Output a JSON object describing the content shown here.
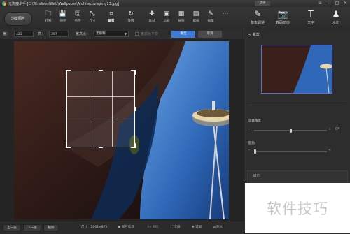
{
  "window": {
    "title": "光影魔术手 [C:\\Windows\\Web\\Wallpaper\\Architecture\\img13.jpg]",
    "login_label": "登录",
    "controls": {
      "menu": "≡",
      "minimize": "–",
      "maximize": "□",
      "close": "✕"
    }
  },
  "toolbar": {
    "browse_label": "浏览图片",
    "tools": [
      {
        "label": "打开",
        "icon": "open-folder-icon",
        "glyph": "🗀"
      },
      {
        "label": "保存",
        "icon": "save-icon",
        "glyph": "💾"
      },
      {
        "label": "另存",
        "icon": "save-as-icon",
        "glyph": "🖫"
      },
      {
        "label": "尺寸",
        "icon": "resize-icon",
        "glyph": "⤡"
      },
      {
        "label": "裁剪",
        "icon": "crop-icon",
        "glyph": "⌗"
      },
      {
        "label": "旋转",
        "icon": "rotate-icon",
        "glyph": "↻"
      },
      {
        "label": "素材",
        "icon": "material-icon",
        "glyph": "✚"
      },
      {
        "label": "边框",
        "icon": "border-icon",
        "glyph": "▣"
      },
      {
        "label": "拼图",
        "icon": "collage-icon",
        "glyph": "▦"
      },
      {
        "label": "模板",
        "icon": "template-icon",
        "glyph": "▤"
      },
      {
        "label": "画笔",
        "icon": "brush-icon",
        "glyph": "✎"
      },
      {
        "label": "...",
        "icon": "more-icon",
        "glyph": "⋯"
      }
    ],
    "right_tools": [
      {
        "label": "基本调整",
        "icon": "basic-adjust-icon",
        "glyph": "✎"
      },
      {
        "label": "数码暗房",
        "icon": "darkroom-icon",
        "glyph": "📷"
      },
      {
        "label": "文字",
        "icon": "text-icon",
        "glyph": "T"
      },
      {
        "label": "水印",
        "icon": "watermark-icon",
        "glyph": "♟"
      }
    ]
  },
  "crop_options": {
    "width_label": "宽：",
    "width_value": "423",
    "height_label": "高：",
    "height_value": "397",
    "ratio_label": "宽高比：",
    "ratio_value": "无限制",
    "keep_ratio_label": "宽高比不变",
    "confirm_label": "确定",
    "cancel_label": "取消"
  },
  "right_panel": {
    "header": "< 裁剪",
    "rotation_label": "旋转角度",
    "rotation_value_label": "0°",
    "rotation_fraction": 0.5,
    "corner_label": "圆角",
    "corner_fraction": 0.0,
    "tips_label": "提示:",
    "minus": "–",
    "plus": "+"
  },
  "statusbar": {
    "prev_label": "上一张",
    "next_label": "下一张",
    "delete_label": "删除",
    "size_text": "尺寸：1061×875",
    "info_label": "图片信息",
    "compare_label": "对比",
    "fullscreen_label": "全屏",
    "fit_label": "适屏",
    "zoom_label": "原大"
  },
  "watermark_text": "软件技巧"
}
